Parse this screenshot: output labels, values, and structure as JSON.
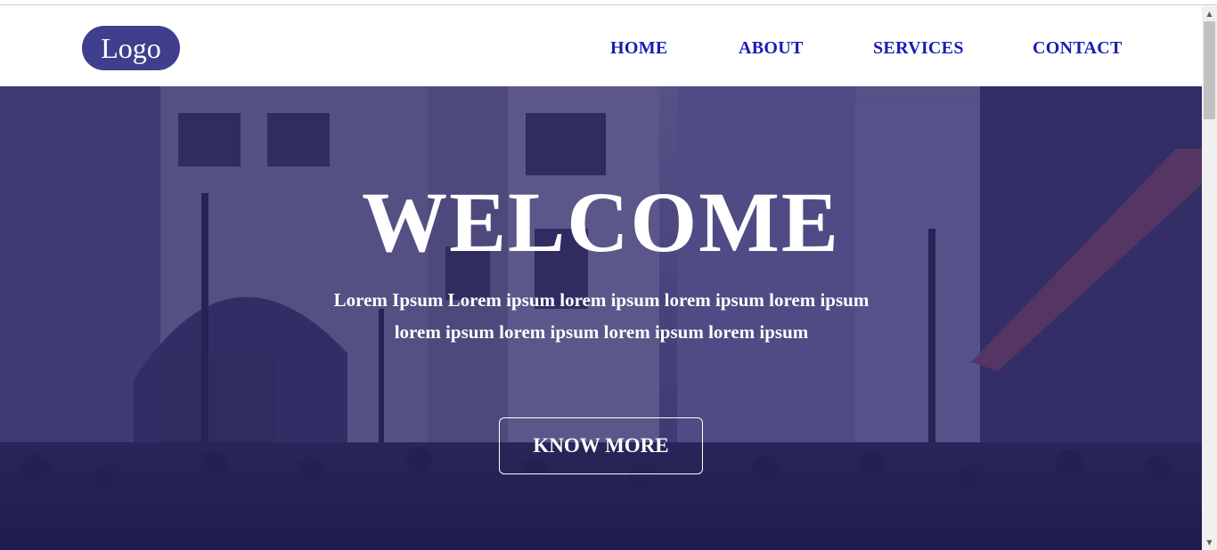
{
  "brand": {
    "logo_text": "Logo",
    "logo_color": "#3f3f8e"
  },
  "nav": {
    "items": [
      {
        "label": "HOME"
      },
      {
        "label": "ABOUT"
      },
      {
        "label": "SERVICES"
      },
      {
        "label": "CONTACT"
      }
    ],
    "link_color": "#1b1bb3"
  },
  "hero": {
    "title": "WELCOME",
    "text_line1": "Lorem Ipsum Lorem ipsum lorem ipsum lorem ipsum lorem ipsum",
    "text_line2": "lorem ipsum lorem ipsum lorem ipsum lorem ipsum",
    "cta_label": "KNOW MORE",
    "overlay_color": "#28246e",
    "background": "city-street-photo"
  },
  "scrollbar": {
    "up_icon": "scroll-up-arrow-icon",
    "down_icon": "scroll-down-arrow-icon"
  }
}
